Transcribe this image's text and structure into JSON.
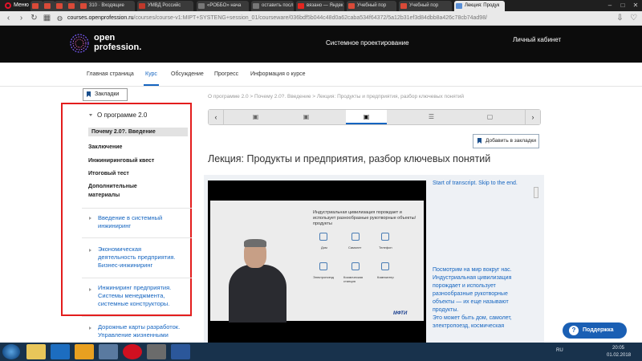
{
  "browser": {
    "menu_label": "Меню",
    "tabs": [
      {
        "label": "",
        "color": "#d94a38"
      },
      {
        "label": "",
        "color": "#d94a38"
      },
      {
        "label": "",
        "color": "#d94a38"
      },
      {
        "label": "",
        "color": "#d94a38"
      },
      {
        "label": "310 · Входящие",
        "color": "#d94a38"
      },
      {
        "label": "УМВД Российс",
        "color": "#c0392b"
      },
      {
        "label": "«РОББО» нача",
        "color": "#777777"
      },
      {
        "label": "оставить посл",
        "color": "#777777"
      },
      {
        "label": "вязано — Яндек",
        "color": "#e52620"
      },
      {
        "label": "Учебный пор",
        "color": "#d94a38"
      },
      {
        "label": "Учебный пор",
        "color": "#d94a38"
      },
      {
        "label": "Лекция: Продук",
        "color": "#5a8fd6"
      }
    ],
    "url_host": "courses.openprofession.ru",
    "url_path": "/courses/course-v1:MIPT+SYSTENG+session_01/courseware/036bdf5b044c48d0a62caba534f64372/5a12b31ef3d84dbb8a426c78cb74ad98/"
  },
  "site": {
    "logo_line1": "open",
    "logo_line2": "profession.",
    "course_name": "Системное проектирование",
    "cabinet_link": "Личный кабинет"
  },
  "course_nav": {
    "tabs": [
      "Главная страница",
      "Курс",
      "Обсуждение",
      "Прогресс",
      "Информация о курсе"
    ],
    "active_index": 1
  },
  "sidebar": {
    "bookmarks_label": "Закладки",
    "section_title": "О программе 2.0",
    "subsections": [
      "Почему 2.0?. Введение",
      "Заключение",
      "Инжиниринговый квест",
      "Итоговый тест",
      "Дополнительные",
      "материалы"
    ],
    "chapters": [
      [
        "Введение в системный",
        "инжиниринг"
      ],
      [
        "Экономическая",
        "деятельность предприятия.",
        "Бизнес-инжиниринг"
      ],
      [
        "Инжиниринг предприятия.",
        "Системы менеджмента,",
        "системные конструкторы."
      ],
      [
        "Дорожные карты разработок.",
        "Управление жизненными"
      ]
    ]
  },
  "main": {
    "breadcrumb": "О программе 2.0 > Почему 2.0?. Введение > Лекция: Продукты и предприятия, разбор ключевых понятий",
    "seq_prev": "‹",
    "seq_next": "›",
    "seq_items": [
      "▣",
      "▣",
      "▣",
      "☰",
      "▢",
      "▣"
    ],
    "seq_active": 2,
    "add_bookmark_label": "Добавить в закладки",
    "lecture_title": "Лекция: Продукты и предприятия, разбор ключевых понятий",
    "slide_text": "Индустриальная цивилизация порождает и использует разнообразные рукотворные объекты/продукты",
    "slide_icons": [
      "Дом",
      "Самолет",
      "Телефон",
      "Электропоезд",
      "Космическая станция",
      "Компьютер"
    ],
    "slide_logo": "МФТИ",
    "transcript_start": "Start of transcript. Skip to the end.",
    "transcript_lines": [
      "Посмотрим на мир вокруг нас.",
      "Индустриальная цивилизация",
      "порождает и использует",
      "разнообразные рукотворные",
      "объекты — их еще называют",
      "продукты.",
      "Это может быть дом, самолет,",
      "электропоезд, космическая"
    ],
    "support_label": "Поддержка"
  },
  "taskbar": {
    "lang": "RU",
    "time": "20:05",
    "date": "01.02.2018"
  }
}
